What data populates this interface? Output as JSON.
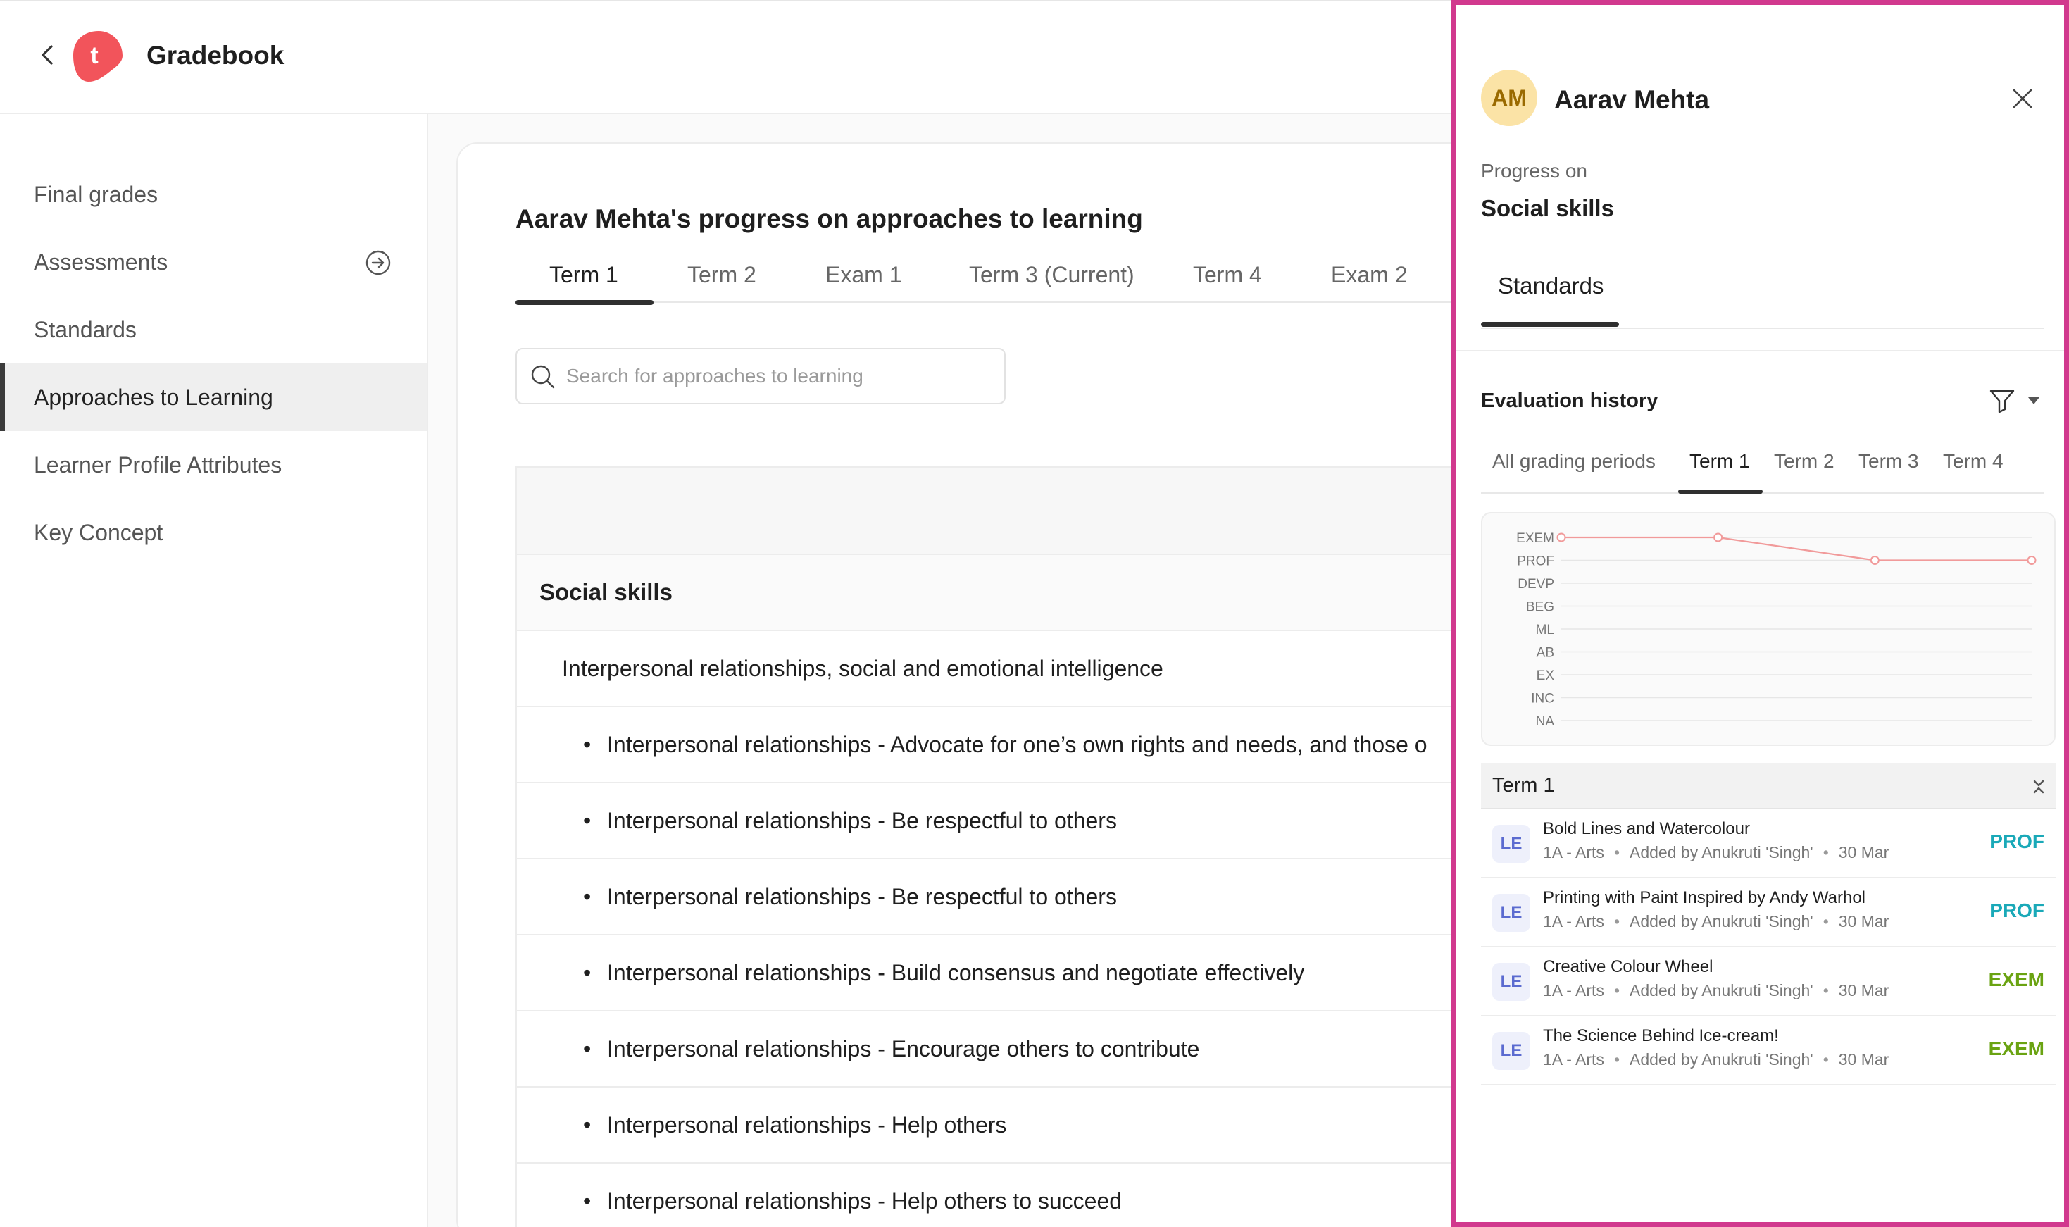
{
  "header": {
    "title": "Gradebook",
    "logo_letter": "t",
    "brand_color": "#f2545b"
  },
  "sidebar": {
    "items": [
      {
        "label": "Final grades",
        "active": false
      },
      {
        "label": "Assessments",
        "active": false,
        "icon": "arrow-circle-right-icon"
      },
      {
        "label": "Standards",
        "active": false
      },
      {
        "label": "Approaches to Learning",
        "active": true
      },
      {
        "label": "Learner Profile Attributes",
        "active": false
      },
      {
        "label": "Key Concept",
        "active": false
      }
    ]
  },
  "main": {
    "title": "Aarav Mehta's progress on approaches to learning",
    "tabs": [
      {
        "label": "Term 1",
        "active": true
      },
      {
        "label": "Term 2",
        "active": false
      },
      {
        "label": "Exam 1",
        "active": false
      },
      {
        "label": "Term 3 (Current)",
        "active": false
      },
      {
        "label": "Term 4",
        "active": false
      },
      {
        "label": "Exam 2",
        "active": false
      }
    ],
    "search": {
      "placeholder": "Search for approaches to learning",
      "value": ""
    },
    "rows": {
      "group": "Social skills",
      "subgroup": "Interpersonal relationships, social and emotional intelligence",
      "items": [
        "Interpersonal relationships - Advocate for one’s own rights and needs, and those o",
        "Interpersonal relationships - Be respectful to others",
        "Interpersonal relationships - Be respectful to others",
        "Interpersonal relationships - Build consensus and negotiate effectively",
        "Interpersonal relationships - Encourage others to contribute",
        "Interpersonal relationships - Help others",
        "Interpersonal relationships - Help others to succeed"
      ]
    }
  },
  "panel": {
    "avatar_initials": "AM",
    "student_name": "Aarav Mehta",
    "progress_label": "Progress on",
    "progress_value": "Social skills",
    "tab": "Standards",
    "evaluation_title": "Evaluation history",
    "eval_tabs": [
      {
        "label": "All grading periods",
        "active": false
      },
      {
        "label": "Term 1",
        "active": true
      },
      {
        "label": "Term 2",
        "active": false
      },
      {
        "label": "Term 3",
        "active": false
      },
      {
        "label": "Term 4",
        "active": false
      }
    ],
    "term_section": "Term 1",
    "evaluations": [
      {
        "badge": "LE",
        "name": "Bold Lines and Watercolour",
        "class": "1A - Arts",
        "added_by": "Added by Anukruti 'Singh'",
        "date": "30 Mar",
        "grade": "PROF",
        "grade_color": "#1aa9b8"
      },
      {
        "badge": "LE",
        "name": "Printing with Paint Inspired by Andy Warhol",
        "class": "1A - Arts",
        "added_by": "Added by Anukruti 'Singh'",
        "date": "30 Mar",
        "grade": "PROF",
        "grade_color": "#1aa9b8"
      },
      {
        "badge": "LE",
        "name": "Creative Colour Wheel",
        "class": "1A - Arts",
        "added_by": "Added by Anukruti 'Singh'",
        "date": "30 Mar",
        "grade": "EXEM",
        "grade_color": "#6aa312"
      },
      {
        "badge": "LE",
        "name": "The Science Behind Ice-cream!",
        "class": "1A - Arts",
        "added_by": "Added by Anukruti 'Singh'",
        "date": "30 Mar",
        "grade": "EXEM",
        "grade_color": "#6aa312"
      }
    ]
  },
  "chart_data": {
    "type": "line",
    "y_categories": [
      "EXEM",
      "PROF",
      "DEVP",
      "BEG",
      "ML",
      "AB",
      "EX",
      "INC",
      "NA"
    ],
    "series": [
      {
        "values": [
          "EXEM",
          "EXEM",
          "PROF",
          "PROF"
        ]
      }
    ],
    "line_color": "#f19a9a",
    "grid": true
  }
}
